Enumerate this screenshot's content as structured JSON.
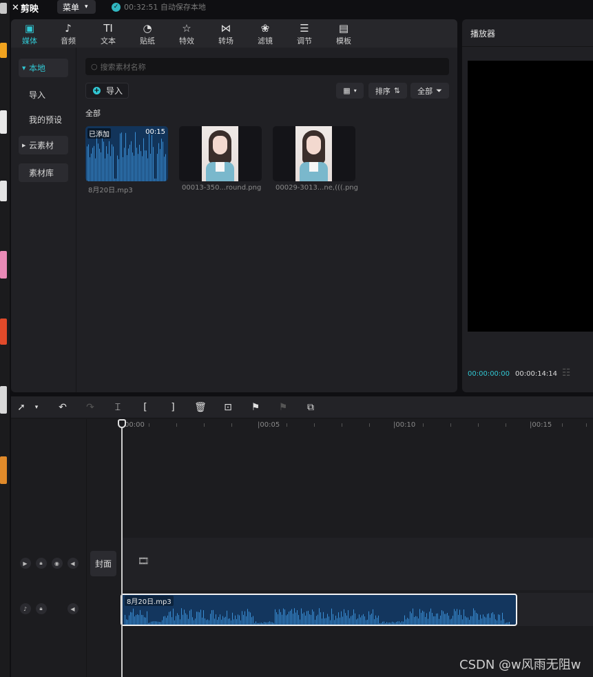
{
  "app": {
    "name": "剪映",
    "menu_label": "菜单",
    "autosave": "00:32:51 自动保存本地"
  },
  "tabs": [
    {
      "label": "媒体",
      "icon": "media-icon"
    },
    {
      "label": "音频",
      "icon": "audio-icon"
    },
    {
      "label": "文本",
      "icon": "text-icon",
      "glyph": "TI"
    },
    {
      "label": "贴纸",
      "icon": "sticker-icon"
    },
    {
      "label": "特效",
      "icon": "effects-icon"
    },
    {
      "label": "转场",
      "icon": "transition-icon"
    },
    {
      "label": "滤镜",
      "icon": "filter-icon"
    },
    {
      "label": "调节",
      "icon": "adjust-icon"
    },
    {
      "label": "模板",
      "icon": "template-icon"
    }
  ],
  "sidebar": {
    "items": [
      {
        "label": "本地"
      },
      {
        "label": "导入"
      },
      {
        "label": "我的预设"
      },
      {
        "label": "云素材"
      },
      {
        "label": "素材库"
      }
    ]
  },
  "library": {
    "search_placeholder": "搜索素材名称",
    "import_label": "导入",
    "sort_label": "排序",
    "filter_label": "全部",
    "section_label": "全部",
    "items": [
      {
        "name": "8月20日.mp3",
        "badge": "已添加",
        "duration": "00:15"
      },
      {
        "name": "00013-350...round.png"
      },
      {
        "name": "00029-3013...ne,(((.png"
      }
    ]
  },
  "player": {
    "title": "播放器",
    "current_time": "00:00:00:00",
    "total_time": "00:00:14:14"
  },
  "timeline": {
    "ruler_labels": [
      "00:00",
      "|00:05",
      "|00:10",
      "|00:15"
    ],
    "cover_label": "封面",
    "audio_clip_label": "8月20日.mp3"
  },
  "watermark": "CSDN @w风雨无阻w",
  "colors": {
    "accent": "#31c7d3",
    "audio_clip": "#13365e",
    "waveform": "#3a8fd6"
  }
}
